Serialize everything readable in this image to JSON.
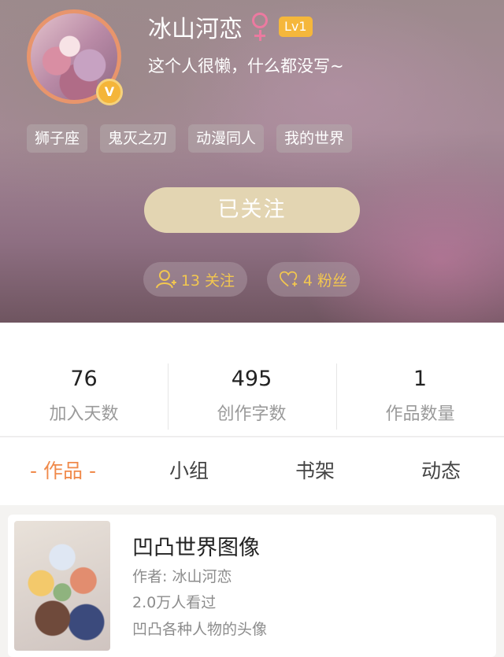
{
  "profile": {
    "username": "冰山河恋",
    "level": "Lv1",
    "bio": "这个人很懒，什么都没写~",
    "vip_badge": "V",
    "tags": [
      "狮子座",
      "鬼灭之刃",
      "动漫同人",
      "我的世界"
    ],
    "follow_button": "已关注",
    "following": "13 关注",
    "fans": "4 粉丝"
  },
  "stats": [
    {
      "value": "76",
      "label": "加入天数"
    },
    {
      "value": "495",
      "label": "创作字数"
    },
    {
      "value": "1",
      "label": "作品数量"
    }
  ],
  "tabs": [
    "- 作品 -",
    "小组",
    "书架",
    "动态"
  ],
  "works": [
    {
      "title": "凹凸世界图像",
      "author": "作者: 冰山河恋",
      "views": "2.0万人看过",
      "description": "凹凸各种人物的头像"
    }
  ],
  "colors": {
    "accent": "#f08a4b",
    "level_badge": "#f5b73b",
    "gender_female": "#ec7aa0",
    "follow_button": "#e3d5b2",
    "pill_text": "#f3c74f"
  }
}
